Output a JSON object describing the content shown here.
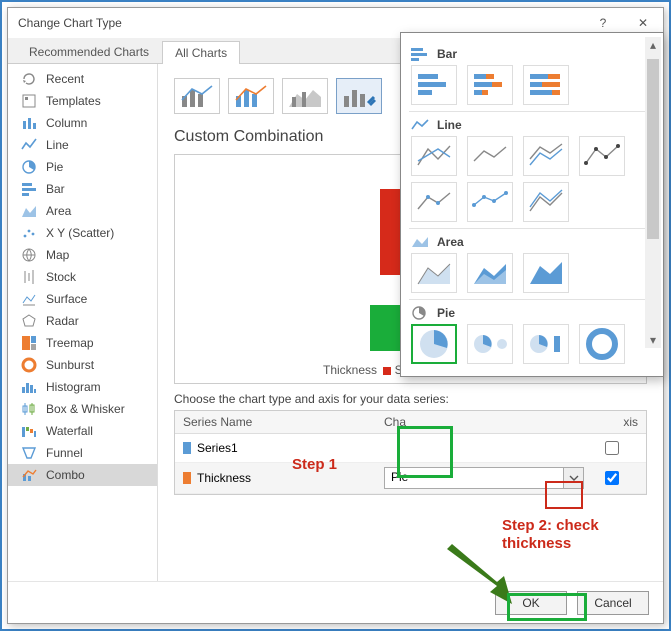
{
  "title": "Change Chart Type",
  "help_symbol": "?",
  "close_symbol": "✕",
  "tabs": {
    "recommended": "Recommended Charts",
    "all": "All Charts"
  },
  "sidebar": {
    "items": [
      {
        "label": "Recent"
      },
      {
        "label": "Templates"
      },
      {
        "label": "Column"
      },
      {
        "label": "Line"
      },
      {
        "label": "Pie"
      },
      {
        "label": "Bar"
      },
      {
        "label": "Area"
      },
      {
        "label": "X Y (Scatter)"
      },
      {
        "label": "Map"
      },
      {
        "label": "Stock"
      },
      {
        "label": "Surface"
      },
      {
        "label": "Radar"
      },
      {
        "label": "Treemap"
      },
      {
        "label": "Sunburst"
      },
      {
        "label": "Histogram"
      },
      {
        "label": "Box & Whisker"
      },
      {
        "label": "Waterfall"
      },
      {
        "label": "Funnel"
      },
      {
        "label": "Combo"
      }
    ]
  },
  "section_title": "Custom Combination",
  "legend_thickness": "Thickness",
  "legend_series_marker": "S",
  "choose_label": "Choose the chart type and axis for your data series:",
  "table": {
    "headers": {
      "series": "Series Name",
      "chart": "Chart Type",
      "axis": "Secondary Axis"
    },
    "header_chart_short": "Cha",
    "header_axis_short": "xis",
    "rows": [
      {
        "name": "Series1",
        "chart": "",
        "secondary": false
      },
      {
        "name": "Thickness",
        "chart": "Pie",
        "secondary": true
      }
    ]
  },
  "dropdown": {
    "categories": {
      "bar": "Bar",
      "line": "Line",
      "area": "Area",
      "pie": "Pie"
    }
  },
  "buttons": {
    "ok": "OK",
    "cancel": "Cancel"
  },
  "annotations": {
    "step1": "Step 1",
    "step2": "Step 2: check thickness"
  }
}
